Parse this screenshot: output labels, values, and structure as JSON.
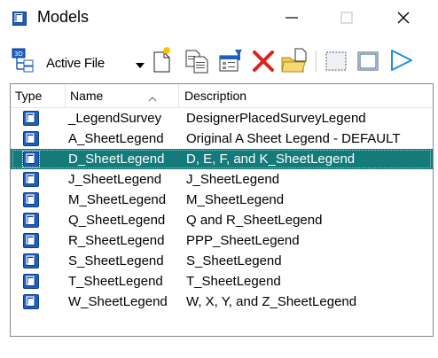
{
  "window": {
    "title": "Models",
    "minimize_glyph": "—",
    "maximize_glyph": "☐",
    "close_glyph": "✕"
  },
  "toolbar": {
    "active_file_label": "Active File",
    "icons": [
      "models-tree-icon",
      "new-model-icon",
      "copy-model-icon",
      "model-properties-icon",
      "delete-model-icon",
      "import-model-icon",
      "select-all-icon",
      "sheet-view-icon"
    ]
  },
  "list": {
    "columns": {
      "type": "Type",
      "name": "Name",
      "description": "Description"
    },
    "sort_glyph": "^",
    "rows": [
      {
        "name": "_LegendSurvey",
        "description": "DesignerPlacedSurveyLegend",
        "selected": false
      },
      {
        "name": "A_SheetLegend",
        "description": "Original A Sheet Legend - DEFAULT",
        "selected": false
      },
      {
        "name": "D_SheetLegend",
        "description": "D, E, F, and K_SheetLegend",
        "selected": true
      },
      {
        "name": "J_SheetLegend",
        "description": "J_SheetLegend",
        "selected": false
      },
      {
        "name": "M_SheetLegend",
        "description": "M_SheetLegend",
        "selected": false
      },
      {
        "name": "Q_SheetLegend",
        "description": "Q and R_SheetLegend",
        "selected": false
      },
      {
        "name": "R_SheetLegend",
        "description": "PPP_SheetLegend",
        "selected": false
      },
      {
        "name": "S_SheetLegend",
        "description": "S_SheetLegend",
        "selected": false
      },
      {
        "name": "T_SheetLegend",
        "description": "T_SheetLegend",
        "selected": false
      },
      {
        "name": "W_SheetLegend",
        "description": "W, X, Y, and Z_SheetLegend",
        "selected": false
      }
    ]
  },
  "colors": {
    "accent": "#1f5fbf",
    "selection": "#157a7a",
    "delete_red": "#e0201c"
  }
}
